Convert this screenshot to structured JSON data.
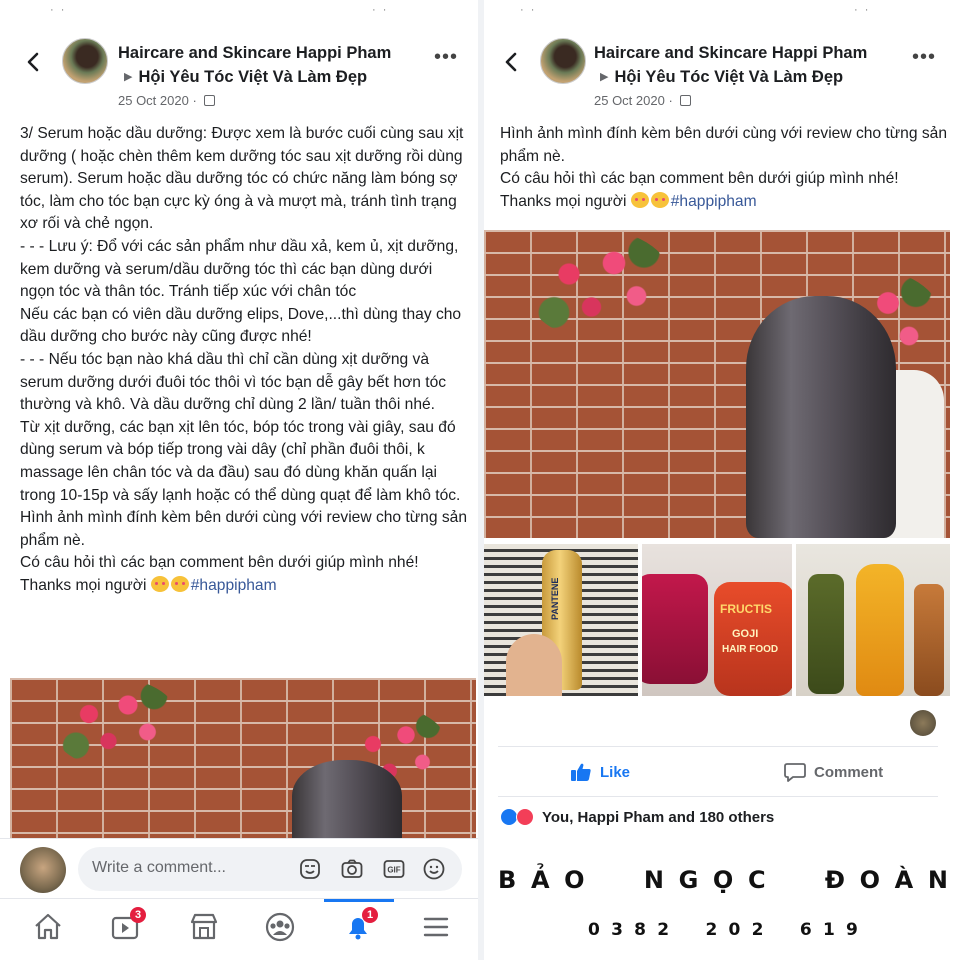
{
  "post": {
    "page_name": "Haircare and Skincare Happi Pham",
    "group_name": "Hội Yêu Tóc Việt Và Làm Đẹp",
    "date": "25 Oct 2020 · "
  },
  "left": {
    "paragraphs": [
      "3/ Serum hoặc dầu dưỡng: Được xem là bước cuối cùng sau xịt dưỡng ( hoặc chèn thêm kem dưỡng tóc sau xịt dưỡng rồi dùng serum). Serum hoặc dầu dưỡng tóc có chức năng làm bóng sợ tóc, làm cho tóc bạn cực kỳ óng à và mượt mà, tránh tình trạng xơ rối và chẻ ngọn.",
      "- - - Lưu ý: Đổ với các sản phẩm như dầu xả, kem ủ, xịt dưỡng, kem dưỡng và serum/dầu dưỡng tóc thì các bạn dùng dưới ngọn tóc và thân tóc. Tránh tiếp xúc với chân tóc",
      "Nếu các bạn có viên dầu dưỡng elips, Dove,...thì dùng thay cho dầu dưỡng cho bước này cũng được nhé!",
      "- - - Nếu tóc bạn nào khá dầu thì chỉ cần dùng xịt dưỡng và serum dưỡng dưới đuôi tóc thôi vì tóc bạn dễ gây bết hơn tóc thường và khô. Và dầu dưỡng chỉ dùng 2 lần/ tuần thôi nhé.",
      "Từ xịt dưỡng, các bạn xịt lên tóc, bóp tóc trong vài giây, sau đó dùng serum và bóp tiếp trong vài dây (chỉ phần đuôi thôi, k massage lên chân tóc và da đầu) sau đó dùng khăn quấn lại trong 10-15p và sấy lạnh hoặc có thể dùng quạt để làm khô tóc.",
      "Hình ảnh mình đính kèm bên dưới cùng với review cho từng sản phẩm nè.",
      "Có câu hỏi thì các bạn comment bên dưới giúp mình nhé!"
    ],
    "thanks": "Thanks mọi người ",
    "hashtag": "#happipham",
    "comment_placeholder": "Write a comment...",
    "badges": {
      "video": "3",
      "notifications": "1"
    }
  },
  "right": {
    "paragraphs": [
      "Hình ảnh mình đính kèm bên dưới cùng với review cho từng sản phẩm nè.",
      "Có câu hỏi thì các bạn comment bên dưới giúp mình nhé!"
    ],
    "thanks": "Thanks mọi người ",
    "hashtag": "#happipham",
    "like_label": "Like",
    "comment_label": "Comment",
    "reactions_text": "You, Happi Pham and 180 others",
    "product_labels": {
      "pantene": "PANTENE",
      "fructis": "FRUCTIS",
      "goji": "GOJI",
      "hair_food": "HAIR FOOD"
    }
  },
  "signature": {
    "name_letters": [
      "B",
      "Ả",
      "O",
      "N",
      "G",
      "Ọ",
      "C",
      "Đ",
      "O",
      "À",
      "N"
    ],
    "phone_digits": [
      "0",
      "3",
      "8",
      "2",
      "2",
      "0",
      "2",
      "6",
      "1",
      "9"
    ]
  }
}
